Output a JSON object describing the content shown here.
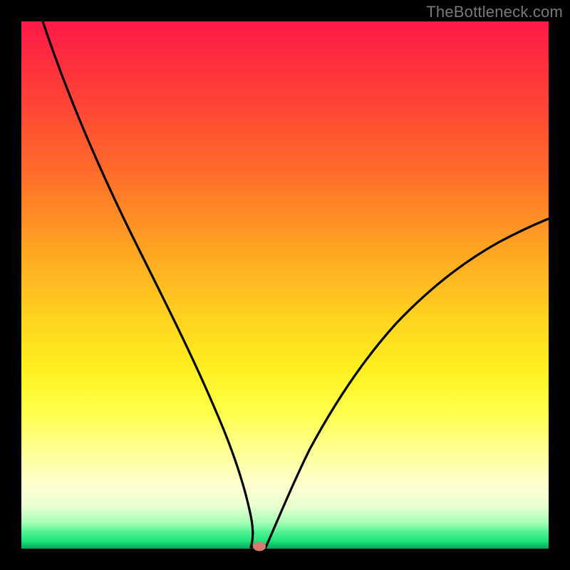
{
  "watermark": "TheBottleneck.com",
  "chart_data": {
    "type": "line",
    "title": "",
    "xlabel": "",
    "ylabel": "",
    "xlim": [
      0,
      100
    ],
    "ylim": [
      0,
      100
    ],
    "x": [
      0,
      5,
      10,
      15,
      20,
      25,
      30,
      35,
      38,
      40,
      42,
      43,
      44,
      46,
      48,
      52,
      56,
      60,
      65,
      70,
      75,
      80,
      85,
      90,
      95,
      100
    ],
    "y": [
      100,
      88,
      77,
      66,
      56,
      46,
      37,
      27,
      18,
      11,
      5,
      2,
      0,
      2,
      6,
      12,
      18,
      24,
      30,
      36,
      41,
      45,
      49,
      52,
      55,
      58
    ],
    "marker": {
      "x": 44,
      "y": 0
    },
    "background_gradient": {
      "top": "#ff1a47",
      "mid": "#ffd21f",
      "bottom": "#10c86a"
    }
  }
}
